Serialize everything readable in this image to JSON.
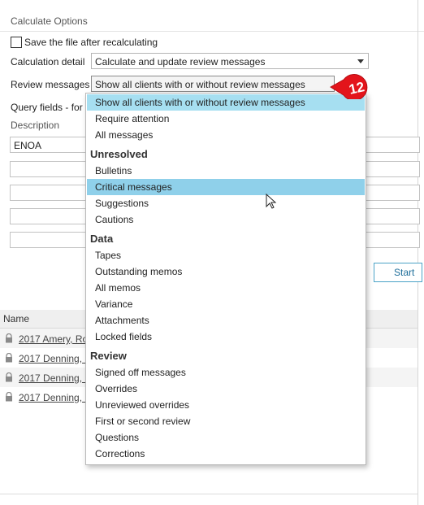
{
  "section_title": "Calculate Options",
  "save_checkbox": {
    "label": "Save the file after recalculating",
    "checked": false
  },
  "calculation_detail": {
    "label": "Calculation detail",
    "value": "Calculate and update review messages"
  },
  "review_messages": {
    "label": "Review messages",
    "value": "Show all clients with or without review messages"
  },
  "query_fields_label": "Query fields - for",
  "description_header": "Description",
  "description_value": "ENOA",
  "start_button": "Start",
  "name_header": "Name",
  "rows": [
    "2017 Amery, Ro",
    "2017 Denning, I",
    "2017 Denning, I",
    "2017 Denning, I"
  ],
  "dropdown": {
    "top_items": [
      "Show all clients with or without review messages",
      "Require attention",
      "All messages"
    ],
    "groups": [
      {
        "title": "Unresolved",
        "items": [
          "Bulletins",
          "Critical messages",
          "Suggestions",
          "Cautions"
        ]
      },
      {
        "title": "Data",
        "items": [
          "Tapes",
          "Outstanding memos",
          "All memos",
          "Variance",
          "Attachments",
          "Locked fields"
        ]
      },
      {
        "title": "Review",
        "items": [
          "Signed off messages",
          "Overrides",
          "Unreviewed overrides",
          "First or second review",
          "Questions",
          "Corrections"
        ]
      }
    ]
  },
  "callout_badge": "12",
  "colors": {
    "highlight": "#a6dff1",
    "badge": "#e3141b",
    "link_blue": "#1e6e9a"
  }
}
